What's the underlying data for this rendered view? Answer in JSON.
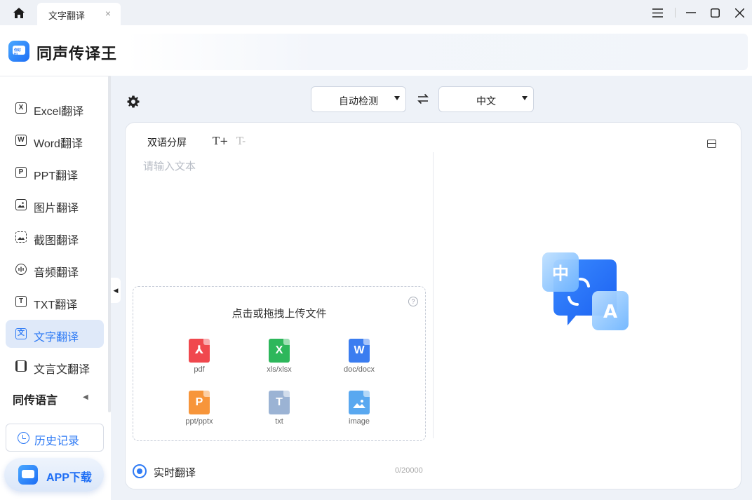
{
  "titlebar": {
    "tab_label": "文字翻译",
    "tab_close": "×"
  },
  "header": {
    "app_name": "同声传译王",
    "logo_text": "你好 Hi"
  },
  "sidebar": {
    "items": [
      {
        "label": "Excel翻译",
        "icon": "excel-icon",
        "glyph": "X"
      },
      {
        "label": "Word翻译",
        "icon": "word-icon",
        "glyph": "W"
      },
      {
        "label": "PPT翻译",
        "icon": "ppt-icon",
        "glyph": "P"
      },
      {
        "label": "图片翻译",
        "icon": "image-icon",
        "glyph": ""
      },
      {
        "label": "截图翻译",
        "icon": "screenshot-icon",
        "glyph": ""
      },
      {
        "label": "音频翻译",
        "icon": "audio-icon",
        "glyph": ""
      },
      {
        "label": "TXT翻译",
        "icon": "txt-icon",
        "glyph": "T"
      },
      {
        "label": "文字翻译",
        "icon": "text-translate-icon",
        "glyph": "文",
        "active": true
      },
      {
        "label": "文言文翻译",
        "icon": "classical-chinese-icon",
        "glyph": ""
      }
    ],
    "section_label": "同传语言",
    "history_label": "历史记录",
    "app_download_label": "APP下载"
  },
  "toolbar": {
    "source_lang": "自动检测",
    "target_lang": "中文"
  },
  "editor": {
    "bilingual_label": "双语分屏",
    "font_increase": "T+",
    "font_decrease": "T-",
    "input_placeholder": "请输入文本",
    "upload_title": "点击或拖拽上传文件",
    "help_glyph": "?",
    "file_types": [
      {
        "label": "pdf",
        "glyph": "⅄",
        "color": "#f0484e"
      },
      {
        "label": "xls/xlsx",
        "glyph": "X",
        "color": "#2db75b"
      },
      {
        "label": "doc/docx",
        "glyph": "W",
        "color": "#3b7df0"
      },
      {
        "label": "ppt/pptx",
        "glyph": "P",
        "color": "#f7953a"
      },
      {
        "label": "txt",
        "glyph": "T",
        "color": "#9bb3d4"
      },
      {
        "label": "image",
        "glyph": "",
        "color": "#59a8f0"
      }
    ],
    "realtime_label": "实时翻译",
    "char_count": "0/20000"
  },
  "illustration": {
    "glyph_a": "中",
    "glyph_b": "A"
  },
  "colors": {
    "accent": "#2f7bf5",
    "sidebar_active_bg": "#dfe9f9",
    "main_bg": "#eef2f8"
  }
}
